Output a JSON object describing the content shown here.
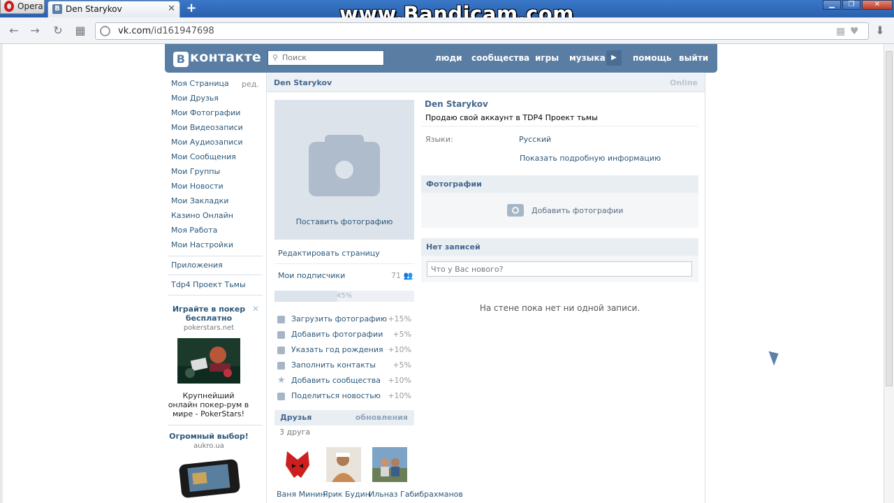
{
  "browser": {
    "opera_label": "Opera",
    "tab_title": "Den Starykov",
    "tab_favicon": "В",
    "newtab": "+",
    "watermark": "www.Bandicam.com",
    "url_domain": "vk.com",
    "url_path": "/id161947698"
  },
  "vk": {
    "logo_letter": "В",
    "logo_text": "контакте",
    "search_placeholder": "Поиск",
    "nav": [
      "люди",
      "сообщества",
      "игры",
      "музыка",
      "помощь",
      "выйти"
    ],
    "left_menu": [
      "Моя Страница",
      "Мои Друзья",
      "Мои Фотографии",
      "Мои Видеозаписи",
      "Мои Аудиозаписи",
      "Мои Сообщения",
      "Мои Группы",
      "Мои Новости",
      "Мои Закладки",
      "Казино Онлайн",
      "Моя Работа",
      "Мои Настройки"
    ],
    "left_edit": "ред.",
    "apps": "Приложения",
    "group": "Tdp4 Проект Тьмы",
    "ad1": {
      "title": "Играйте в покер бесплатно",
      "domain": "pokerstars.net",
      "desc": "Крупнейший онлайн покер-рум в мире - PokerStars!"
    },
    "ad2": {
      "title": "Огромный выбор!",
      "domain": "aukro.ua"
    },
    "profile": {
      "name": "Den Starykov",
      "online": "Online",
      "status": "Продаю свой аккаунт в TDP4 Проект тьмы",
      "lang_label": "Языки:",
      "lang_value": "Русский",
      "more": "Показать подробную информацию",
      "put_photo": "Поставить фотографию",
      "edit_page": "Редактировать страницу",
      "subscribers": "Мои подписчики",
      "subscribers_count": "71",
      "progress_label": "45%",
      "progress_value": 0.45,
      "steps": [
        {
          "label": "Загрузить фотографию",
          "pct": "+15%"
        },
        {
          "label": "Добавить фотографии",
          "pct": "+5%"
        },
        {
          "label": "Указать год рождения",
          "pct": "+10%"
        },
        {
          "label": "Заполнить контакты",
          "pct": "+5%"
        },
        {
          "label": "Добавить сообщества",
          "pct": "+10%"
        },
        {
          "label": "Поделиться новостью",
          "pct": "+10%"
        }
      ],
      "friends_title": "Друзья",
      "friends_updates": "обновления",
      "friends_count": "3 друга",
      "friends": [
        "Ваня Минин",
        "Ярик Будин",
        "Ильназ Габибрахманов"
      ],
      "photos_title": "Фотографии",
      "add_photos": "Добавить фотографии",
      "wall_title": "Нет записей",
      "wall_placeholder": "Что у Вас нового?",
      "wall_empty": "На стене пока нет ни одной записи."
    }
  }
}
